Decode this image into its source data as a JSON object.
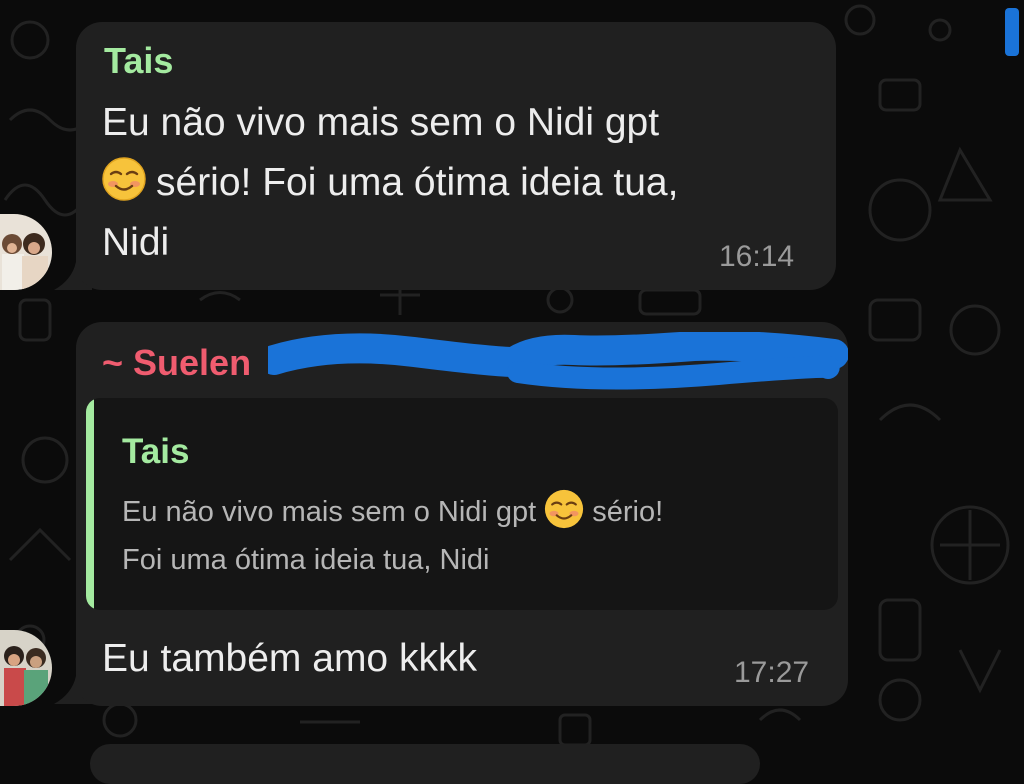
{
  "colors": {
    "background": "#0b0b0b",
    "bubble": "#202020",
    "quote_background": "#151515",
    "tais_name": "#a4eaa0",
    "suelen_name": "#ef5c6f",
    "quote_bar": "#a4eaa0",
    "redaction": "#1a73d8"
  },
  "messages": [
    {
      "sender": "Tais",
      "text_line1": "Eu não vivo mais sem o Nidi gpt",
      "text_line2": "sério! Foi uma ótima ideia tua,",
      "text_line3": "Nidi",
      "emoji": "smiling-face-icon",
      "time": "16:14"
    },
    {
      "sender": "~ Suelen",
      "sender_detail_redacted": true,
      "quote": {
        "sender": "Tais",
        "line1": "Eu não vivo mais sem o Nidi gpt",
        "line1_tail": "sério!",
        "line2": "Foi uma ótima ideia tua, Nidi"
      },
      "text": "Eu também amo kkkk",
      "time": "17:27"
    }
  ]
}
